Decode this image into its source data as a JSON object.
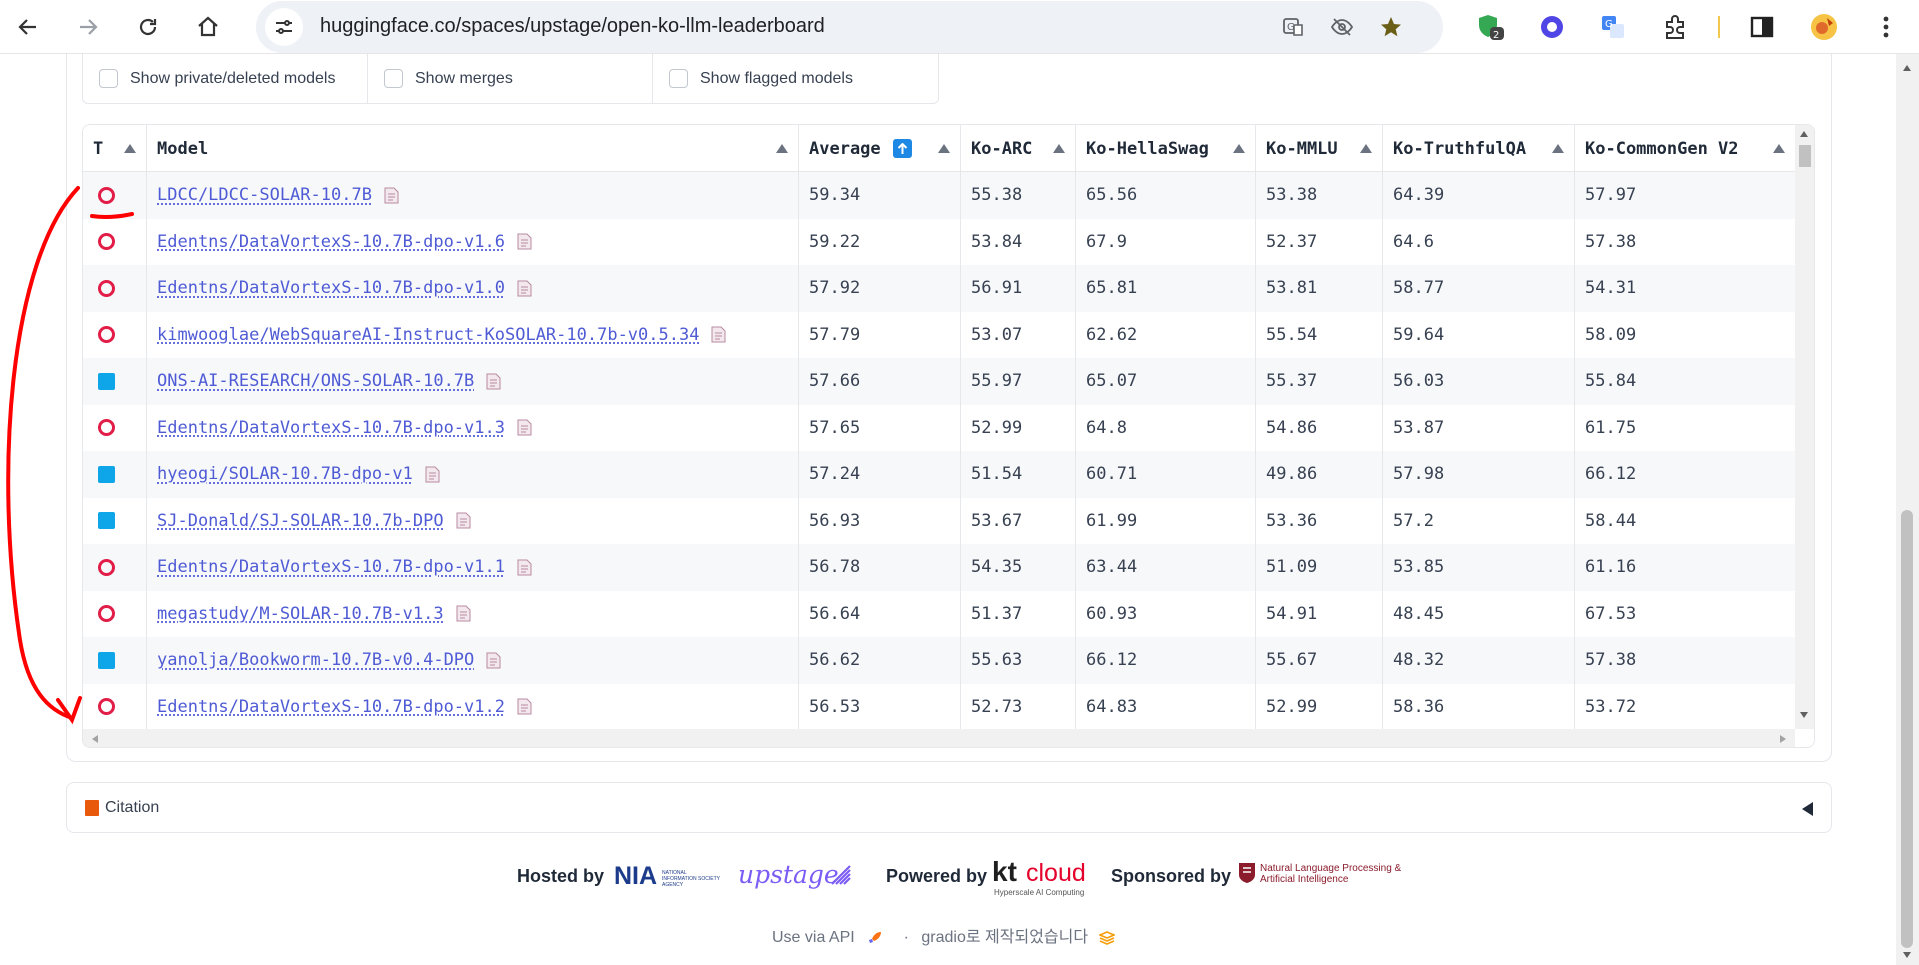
{
  "browser": {
    "url": "huggingface.co/spaces/upstage/open-ko-llm-leaderboard",
    "extension_badge": "2"
  },
  "filters": [
    {
      "label": "Show private/deleted models",
      "checked": false
    },
    {
      "label": "Show merges",
      "checked": false
    },
    {
      "label": "Show flagged models",
      "checked": false
    }
  ],
  "table": {
    "headers": [
      "T",
      "Model",
      "Average",
      "Ko-ARC",
      "Ko-HellaSwag",
      "Ko-MMLU",
      "Ko-TruthfulQA",
      "Ko-CommonGen V2"
    ],
    "rows": [
      {
        "type": "circle",
        "model": "LDCC/LDCC-SOLAR-10.7B",
        "average": "59.34",
        "arc": "55.38",
        "hellaswag": "65.56",
        "mmlu": "53.38",
        "truthfulqa": "64.39",
        "commongen": "57.97"
      },
      {
        "type": "circle",
        "model": "Edentns/DataVortexS-10.7B-dpo-v1.6",
        "average": "59.22",
        "arc": "53.84",
        "hellaswag": "67.9",
        "mmlu": "52.37",
        "truthfulqa": "64.6",
        "commongen": "57.38"
      },
      {
        "type": "circle",
        "model": "Edentns/DataVortexS-10.7B-dpo-v1.0",
        "average": "57.92",
        "arc": "56.91",
        "hellaswag": "65.81",
        "mmlu": "53.81",
        "truthfulqa": "58.77",
        "commongen": "54.31"
      },
      {
        "type": "circle",
        "model": "kimwooglae/WebSquareAI-Instruct-KoSOLAR-10.7b-v0.5.34",
        "average": "57.79",
        "arc": "53.07",
        "hellaswag": "62.62",
        "mmlu": "55.54",
        "truthfulqa": "59.64",
        "commongen": "58.09"
      },
      {
        "type": "square",
        "model": "ONS-AI-RESEARCH/ONS-SOLAR-10.7B",
        "average": "57.66",
        "arc": "55.97",
        "hellaswag": "65.07",
        "mmlu": "55.37",
        "truthfulqa": "56.03",
        "commongen": "55.84"
      },
      {
        "type": "circle",
        "model": "Edentns/DataVortexS-10.7B-dpo-v1.3",
        "average": "57.65",
        "arc": "52.99",
        "hellaswag": "64.8",
        "mmlu": "54.86",
        "truthfulqa": "53.87",
        "commongen": "61.75"
      },
      {
        "type": "square",
        "model": "hyeogi/SOLAR-10.7B-dpo-v1",
        "average": "57.24",
        "arc": "51.54",
        "hellaswag": "60.71",
        "mmlu": "49.86",
        "truthfulqa": "57.98",
        "commongen": "66.12"
      },
      {
        "type": "square",
        "model": "SJ-Donald/SJ-SOLAR-10.7b-DPO",
        "average": "56.93",
        "arc": "53.67",
        "hellaswag": "61.99",
        "mmlu": "53.36",
        "truthfulqa": "57.2",
        "commongen": "58.44"
      },
      {
        "type": "circle",
        "model": "Edentns/DataVortexS-10.7B-dpo-v1.1",
        "average": "56.78",
        "arc": "54.35",
        "hellaswag": "63.44",
        "mmlu": "51.09",
        "truthfulqa": "53.85",
        "commongen": "61.16"
      },
      {
        "type": "circle",
        "model": "megastudy/M-SOLAR-10.7B-v1.3",
        "average": "56.64",
        "arc": "51.37",
        "hellaswag": "60.93",
        "mmlu": "54.91",
        "truthfulqa": "48.45",
        "commongen": "67.53"
      },
      {
        "type": "square",
        "model": "yanolja/Bookworm-10.7B-v0.4-DPO",
        "average": "56.62",
        "arc": "55.63",
        "hellaswag": "66.12",
        "mmlu": "55.67",
        "truthfulqa": "48.32",
        "commongen": "57.38"
      },
      {
        "type": "circle",
        "model": "Edentns/DataVortexS-10.7B-dpo-v1.2",
        "average": "56.53",
        "arc": "52.73",
        "hellaswag": "64.83",
        "mmlu": "52.99",
        "truthfulqa": "58.36",
        "commongen": "53.72"
      }
    ]
  },
  "citation": {
    "label": "Citation"
  },
  "footer": {
    "hosted_by": "Hosted by",
    "nia_logo": "NIA",
    "nia_sub": "NATIONAL INFORMATION SOCIETY AGENCY",
    "upstage_logo": "upstage",
    "powered_by": "Powered by",
    "kt_logo": "kt",
    "cloud_logo": "cloud",
    "kt_sub": "Hyperscale AI Computing",
    "sponsored_by": "Sponsored by",
    "nlp_logo": "Natural Language Processing & Artificial Intelligence",
    "use_via_api": "Use via API",
    "separator": "·",
    "built_with": "gradio로 제작되었습니다"
  },
  "colors": {
    "accent": "#1e88e5",
    "link": "#4f5bd5",
    "type_circle": "#e11d48",
    "type_square": "#0ea5e9",
    "annotation": "#ff0000"
  }
}
